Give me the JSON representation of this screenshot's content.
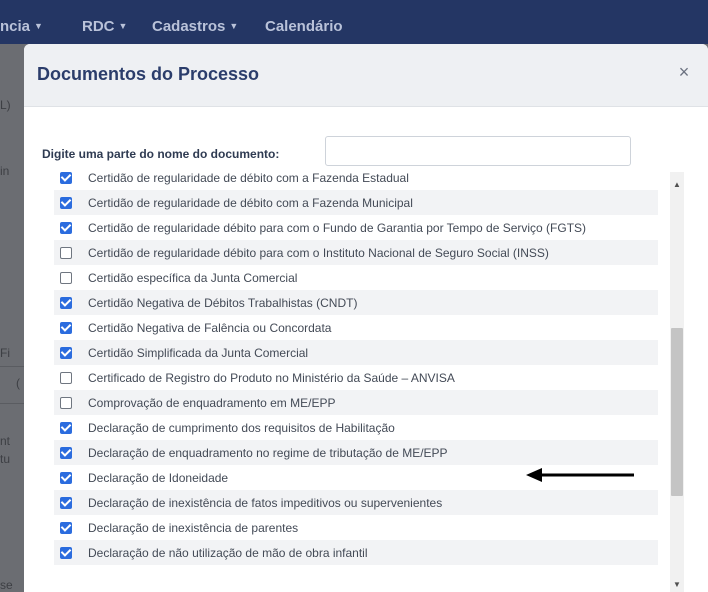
{
  "nav": {
    "items": [
      "ncia",
      "RDC",
      "Cadastros",
      "Calendário"
    ]
  },
  "background": {
    "fragments": [
      "L)",
      "in",
      "Fi",
      "(",
      "nt",
      "tu",
      "se"
    ]
  },
  "modal": {
    "title": "Documentos do Processo",
    "close": "×",
    "search_label": "Digite uma parte do nome do documento:",
    "search_value": ""
  },
  "documents": [
    {
      "label": "Certidão de regularidade de débito com a Fazenda Estadual",
      "checked": true
    },
    {
      "label": "Certidão de regularidade de débito com a Fazenda Municipal",
      "checked": true
    },
    {
      "label": "Certidão de regularidade débito para com o Fundo de Garantia por Tempo de Serviço (FGTS)",
      "checked": true
    },
    {
      "label": "Certidão de regularidade débito para com o Instituto Nacional de Seguro Social (INSS)",
      "checked": false
    },
    {
      "label": "Certidão específica da Junta Comercial",
      "checked": false
    },
    {
      "label": "Certidão Negativa de Débitos Trabalhistas (CNDT)",
      "checked": true
    },
    {
      "label": "Certidão Negativa de Falência ou Concordata",
      "checked": true
    },
    {
      "label": "Certidão Simplificada da Junta Comercial",
      "checked": true
    },
    {
      "label": "Certificado de Registro do Produto no Ministério da Saúde – ANVISA",
      "checked": false
    },
    {
      "label": "Comprovação de enquadramento em ME/EPP",
      "checked": false
    },
    {
      "label": "Declaração de cumprimento dos requisitos de Habilitação",
      "checked": true
    },
    {
      "label": "Declaração de enquadramento no regime de tributação de ME/EPP",
      "checked": true
    },
    {
      "label": "Declaração de Idoneidade",
      "checked": true
    },
    {
      "label": "Declaração de inexistência de fatos impeditivos ou supervenientes",
      "checked": true
    },
    {
      "label": "Declaração de inexistência de parentes",
      "checked": true
    },
    {
      "label": "Declaração de não utilização de mão de obra infantil",
      "checked": true
    }
  ],
  "scrollbar": {
    "up_icon": "▲",
    "down_icon": "▼",
    "position_fraction": 0.45
  },
  "annotation": {
    "icon": "left-arrow-icon",
    "color": "#000000"
  },
  "colors": {
    "header_bg": "#243664",
    "checkbox_on": "#2b6cde",
    "title": "#2b3d6b"
  }
}
